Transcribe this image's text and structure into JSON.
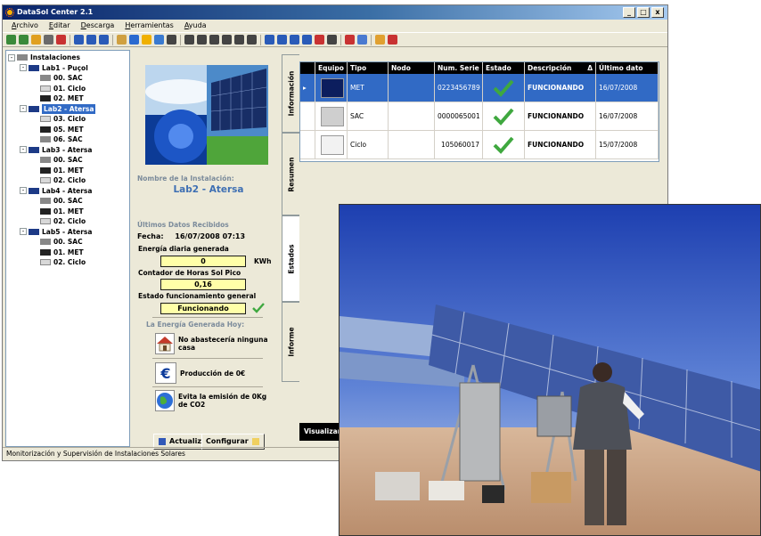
{
  "window": {
    "title": "DataSol Center 2.1",
    "controls": [
      "_",
      "□",
      "x"
    ]
  },
  "menu": [
    "Archivo",
    "Editar",
    "Descarga",
    "Herramientas",
    "Ayuda"
  ],
  "toolbar": {
    "icons": [
      "refresh-icon",
      "refresh-icon",
      "folder-icon",
      "print-icon",
      "delete-icon",
      "grid-icon",
      "grid-icon",
      "globe-icon",
      "hand-icon",
      "cloud-icon",
      "sun-icon",
      "image-icon",
      "chart-icon",
      "chart-icon",
      "chart-icon",
      "chart-icon",
      "chart-icon",
      "chart-icon",
      "chart-icon",
      "chart-icon",
      "chart-icon",
      "chart-icon",
      "chart-icon",
      "chart-icon",
      "chart-icon",
      "cross-icon",
      "person-icon",
      "person-icon",
      "stop-icon"
    ]
  },
  "tree": [
    {
      "label": "Instalaciones",
      "level": 0,
      "expand": "-",
      "icon": "folder-icon"
    },
    {
      "label": "Lab1 - Puçol",
      "level": 1,
      "expand": "-",
      "icon": "solar-panel-icon"
    },
    {
      "label": "00. SAC",
      "level": 2,
      "icon": "sac-device-icon"
    },
    {
      "label": "01. Ciclo",
      "level": 2,
      "icon": "ciclo-device-icon"
    },
    {
      "label": "02. MET",
      "level": 2,
      "icon": "met-device-icon"
    },
    {
      "label": "Lab2 - Atersa",
      "level": 1,
      "expand": "-",
      "icon": "solar-panel-icon",
      "selected": true
    },
    {
      "label": "03. Ciclo",
      "level": 2,
      "icon": "ciclo-device-icon"
    },
    {
      "label": "05. MET",
      "level": 2,
      "icon": "met-device-icon"
    },
    {
      "label": "06. SAC",
      "level": 2,
      "icon": "sac-device-icon"
    },
    {
      "label": "Lab3 - Atersa",
      "level": 1,
      "expand": "-",
      "icon": "solar-panel-icon"
    },
    {
      "label": "00. SAC",
      "level": 2,
      "icon": "sac-device-icon"
    },
    {
      "label": "01. MET",
      "level": 2,
      "icon": "met-device-icon"
    },
    {
      "label": "02. Ciclo",
      "level": 2,
      "icon": "ciclo-device-icon"
    },
    {
      "label": "Lab4 - Atersa",
      "level": 1,
      "expand": "-",
      "icon": "solar-panel-icon"
    },
    {
      "label": "00. SAC",
      "level": 2,
      "icon": "sac-device-icon"
    },
    {
      "label": "01. MET",
      "level": 2,
      "icon": "met-device-icon"
    },
    {
      "label": "02. Ciclo",
      "level": 2,
      "icon": "ciclo-device-icon"
    },
    {
      "label": "Lab5 - Atersa",
      "level": 1,
      "expand": "-",
      "icon": "solar-panel-icon"
    },
    {
      "label": "00. SAC",
      "level": 2,
      "icon": "sac-device-icon"
    },
    {
      "label": "01. MET",
      "level": 2,
      "icon": "met-device-icon"
    },
    {
      "label": "02. Ciclo",
      "level": 2,
      "icon": "ciclo-device-icon"
    }
  ],
  "info": {
    "install_name_label": "Nombre de la Instalación:",
    "install_name": "Lab2 - Atersa",
    "last_data_label": "Últimos Datos Recibidos",
    "date_label": "Fecha:",
    "date_value": "16/07/2008 07:13",
    "energy_label": "Energía diaria generada",
    "energy_value": "0",
    "energy_unit": "KWh",
    "hours_label": "Contador de Horas Sol Pico",
    "hours_value": "0,16",
    "status_label": "Estado funcionamiento general",
    "status_value": "Funcionando",
    "today_label": "La Energía Generada Hoy:",
    "houses_text": "No abastecería ninguna casa",
    "production_text": "Producción de 0€",
    "co2_text": "Evita la emisión de 0Kg de CO2",
    "update_button": "Actualizar",
    "config_button": "Configurar"
  },
  "tabs": [
    "Información",
    "Resumen",
    "Estados",
    "Informe"
  ],
  "grid": {
    "headers": [
      "",
      "Equipo",
      "Tipo",
      "Nodo",
      "Num. Serie",
      "Estado",
      "Descripción",
      "Último dato"
    ],
    "rows": [
      {
        "selected": true,
        "equipo": "met-device-icon",
        "tipo": "MET",
        "nodo": "",
        "serie": "0223456789",
        "estado": "check-icon",
        "descripcion": "FUNCIONANDO",
        "ultimo": "16/07/2008"
      },
      {
        "selected": false,
        "equipo": "sac-device-icon",
        "tipo": "SAC",
        "nodo": "",
        "serie": "0000065001",
        "estado": "check-icon",
        "descripcion": "FUNCIONANDO",
        "ultimo": "16/07/2008"
      },
      {
        "selected": false,
        "equipo": "ciclo-device-icon",
        "tipo": "Ciclo",
        "nodo": "",
        "serie": "105060017",
        "estado": "check-icon",
        "descripcion": "FUNCIONANDO",
        "ultimo": "15/07/2008"
      }
    ],
    "sort_indicator": "Δ"
  },
  "visualizar_label": "Visualizar",
  "statusbar": "Monitorización y Supervisión de Instalaciones Solares",
  "colors": {
    "selection": "#316ac5",
    "field_bg": "#ffffa8",
    "check_green": "#3fa83f",
    "title_blue": "#0a246a"
  }
}
